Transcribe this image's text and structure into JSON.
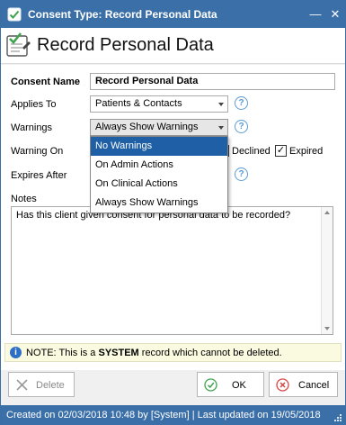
{
  "window": {
    "title": "Consent Type: Record Personal Data",
    "minimize_glyph": "—",
    "close_glyph": "✕"
  },
  "header": {
    "title": "Record Personal Data",
    "icon": "checklist-icon"
  },
  "form": {
    "consent_name_label": "Consent Name",
    "consent_name_value": "Record Personal Data",
    "applies_to_label": "Applies To",
    "applies_to_value": "Patients & Contacts",
    "warnings_label": "Warnings",
    "warnings_value": "Always Show Warnings",
    "warning_on_label": "Warning On",
    "declined_label": "Declined",
    "declined_checked": true,
    "expired_label": "Expired",
    "expired_checked": true,
    "expires_after_label": "Expires After",
    "notes_label": "Notes",
    "notes_value": "Has this client given consent for personal data to be recorded?",
    "help_glyph": "?",
    "check_glyph": "✓"
  },
  "warnings_dropdown": {
    "options": [
      "No Warnings",
      "On Admin Actions",
      "On Clinical Actions",
      "Always Show Warnings"
    ],
    "highlighted_index": 0
  },
  "system_note": {
    "prefix": "NOTE: This is a ",
    "emphasis": "SYSTEM",
    "suffix": " record which cannot be deleted.",
    "info_glyph": "i"
  },
  "buttons": {
    "delete_label": "Delete",
    "ok_label": "OK",
    "cancel_label": "Cancel"
  },
  "status_bar": {
    "text": "Created on 02/03/2018 10:48 by [System] | Last updated on 19/05/2018"
  },
  "colors": {
    "titlebar": "#3b6fa7",
    "selection": "#1f5fa6",
    "ok_green": "#3fa34d",
    "cancel_red": "#d64545"
  }
}
